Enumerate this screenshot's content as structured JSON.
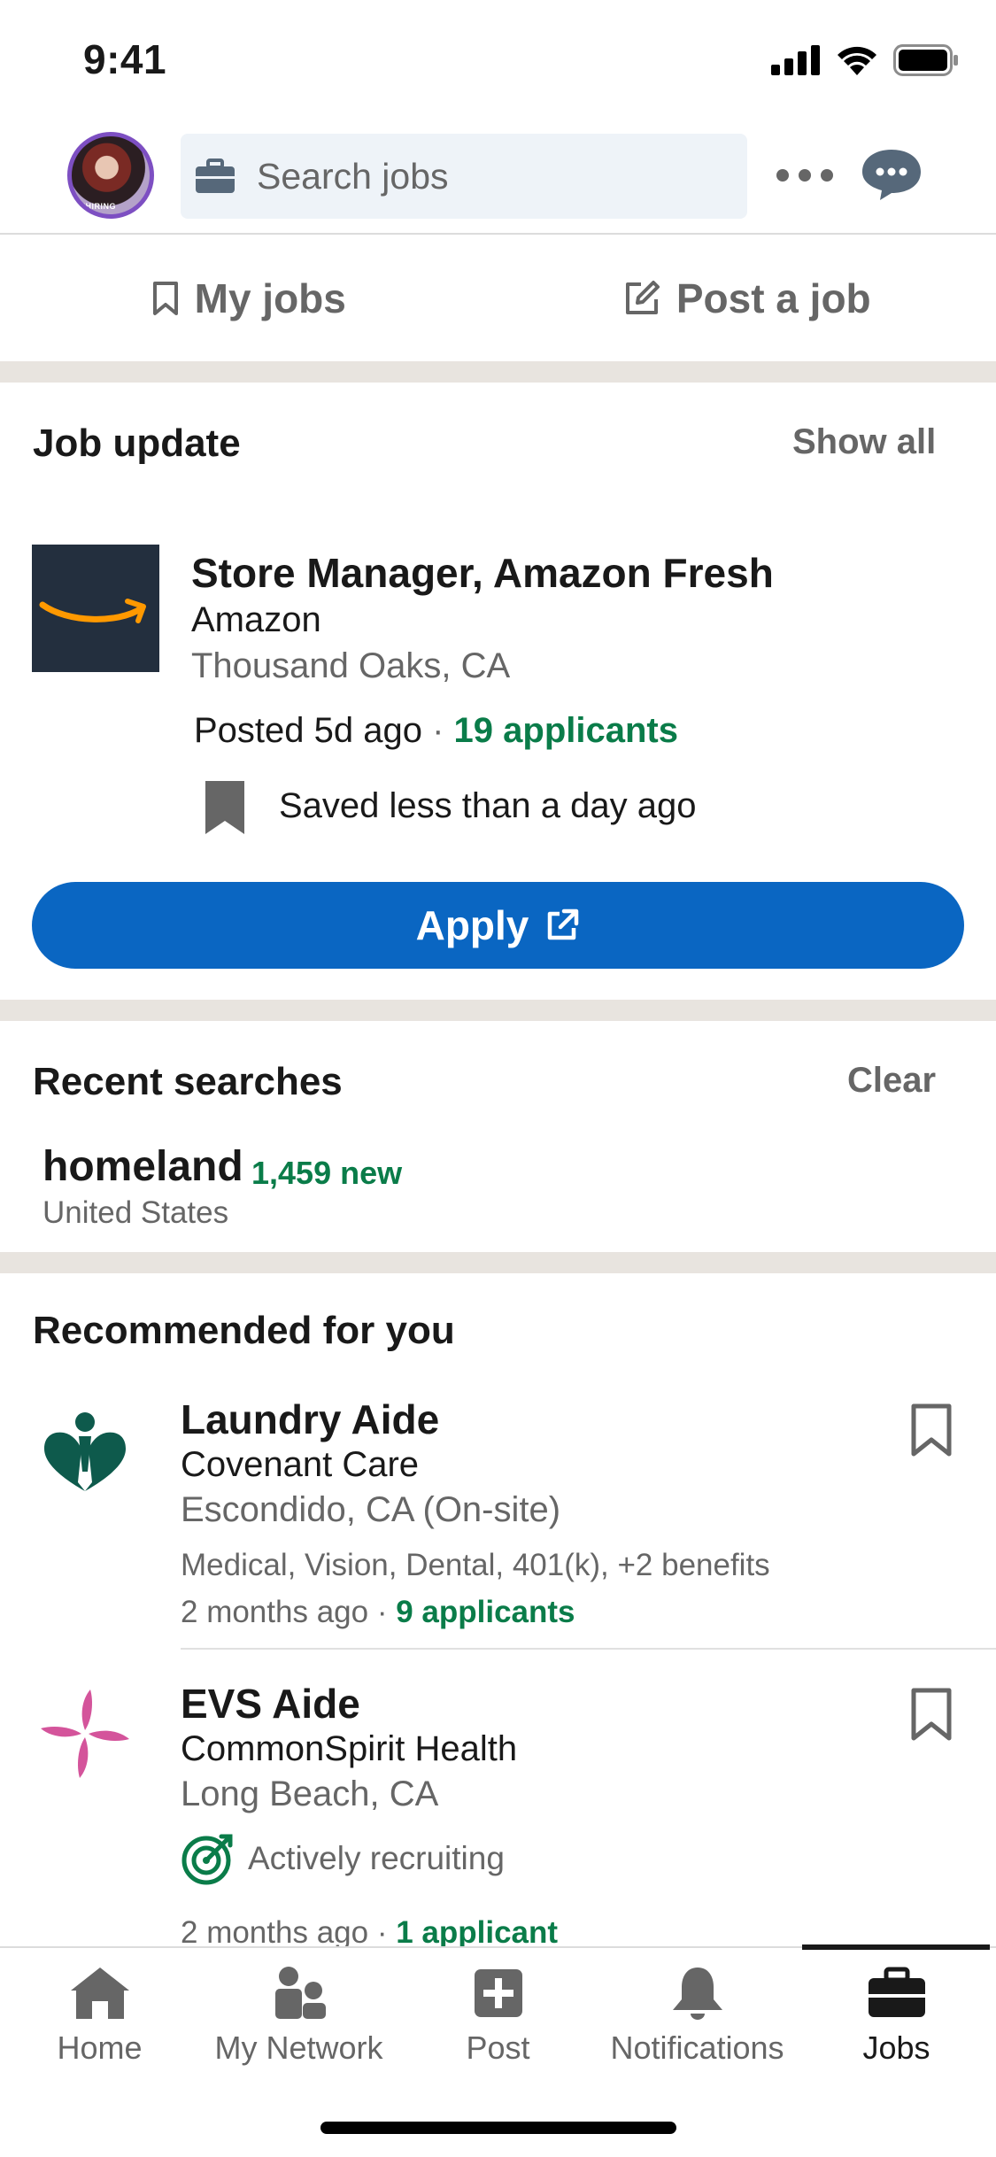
{
  "status_bar": {
    "time": "9:41"
  },
  "top_nav": {
    "avatar_badge": "#HIRING",
    "search_placeholder": "Search jobs"
  },
  "job_tabs": {
    "my_jobs": "My jobs",
    "post_job": "Post a job"
  },
  "job_update": {
    "heading": "Job update",
    "show_all": "Show all",
    "title": "Store Manager, Amazon Fresh",
    "company": "Amazon",
    "location": "Thousand Oaks, CA",
    "posted": "Posted 5d ago",
    "separator": " · ",
    "applicants": "19 applicants",
    "saved": "Saved less than a day ago",
    "apply_label": "Apply"
  },
  "recent_searches": {
    "heading": "Recent searches",
    "clear": "Clear",
    "query": "homeland",
    "new_count": "1,459 new",
    "location": "United States"
  },
  "recommended": {
    "heading": "Recommended for you",
    "items": [
      {
        "title": "Laundry Aide",
        "company": "Covenant Care",
        "location": "Escondido, CA (On-site)",
        "benefits": "Medical, Vision, Dental, 401(k), +2 benefits",
        "age": "2 months ago",
        "separator": " · ",
        "applicants": "9 applicants"
      },
      {
        "title": "EVS Aide",
        "company": "CommonSpirit Health",
        "location": "Long Beach, CA",
        "recruiting": "Actively recruiting",
        "age": "2 months ago",
        "separator": " · ",
        "applicants": "1 applicant"
      }
    ]
  },
  "tab_bar": {
    "tabs": [
      "Home",
      "My Network",
      "Post",
      "Notifications",
      "Jobs"
    ],
    "active": "Jobs"
  },
  "colors": {
    "brand_blue": "#0a66c2",
    "success_green": "#0a7c49",
    "amazon_navy": "#232f3e",
    "amazon_orange": "#ff9900",
    "covenant_green": "#0e5a4c",
    "commonspirit_pink": "#d4549b"
  }
}
